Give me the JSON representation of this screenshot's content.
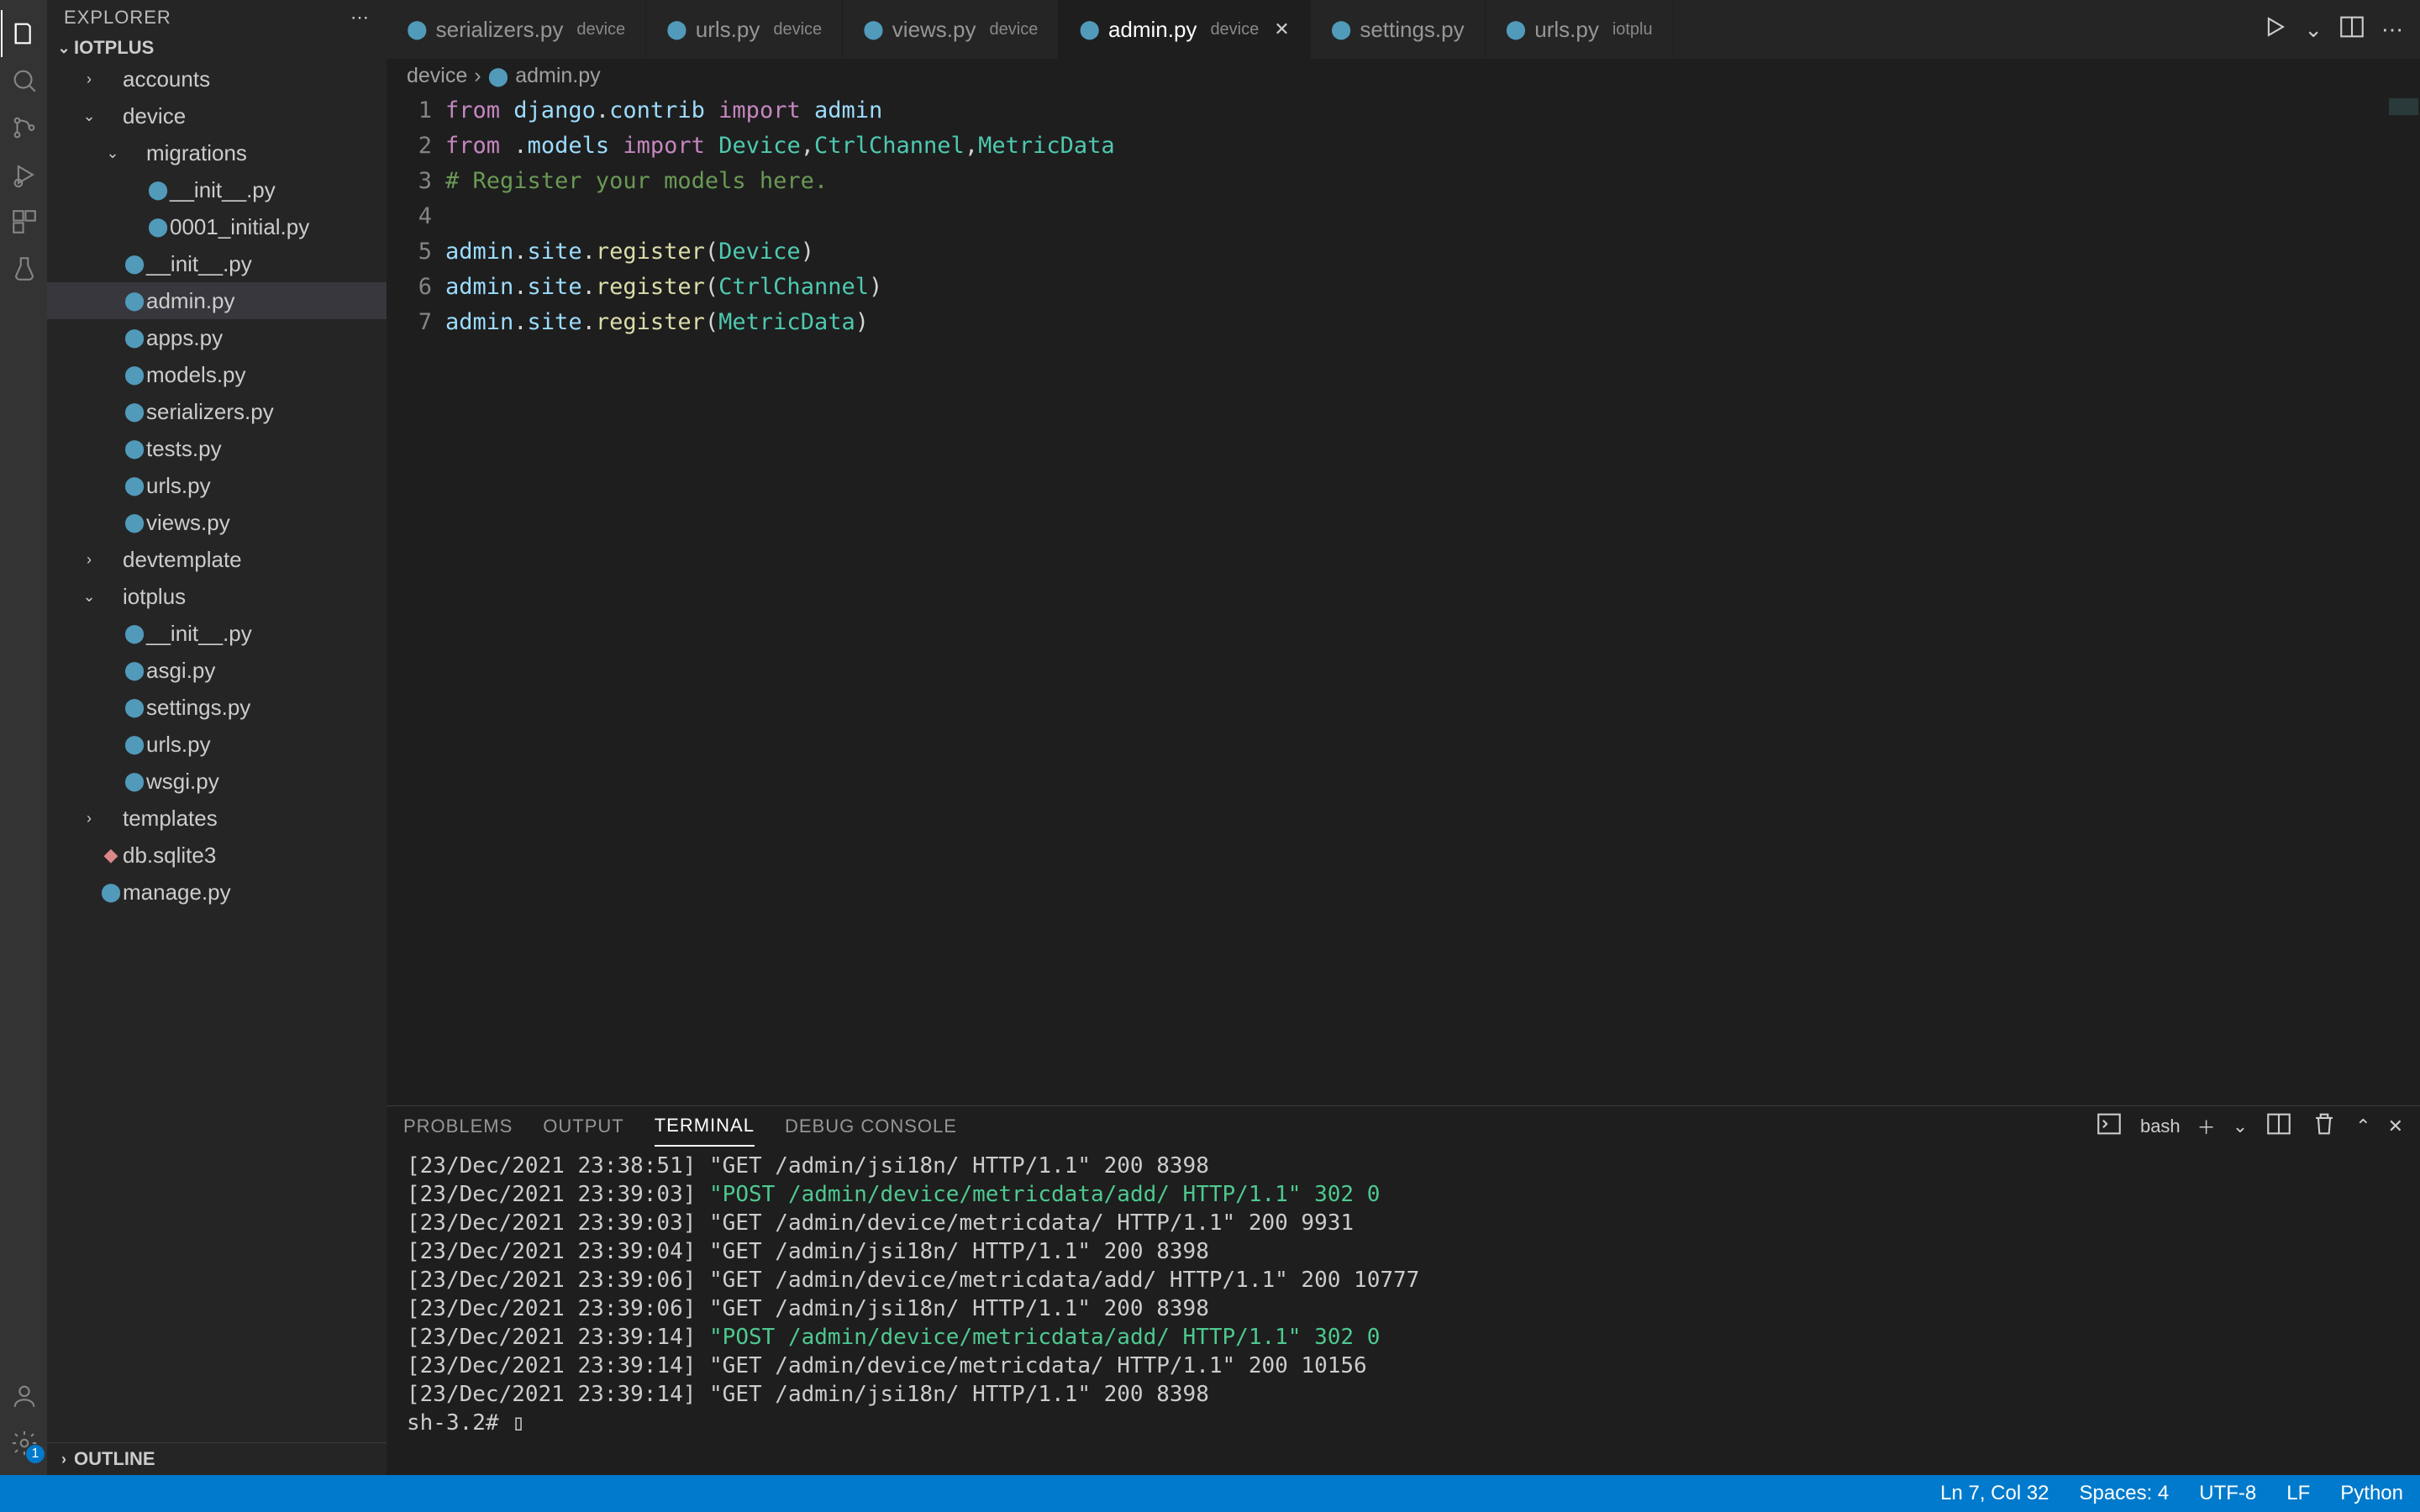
{
  "sidebar": {
    "title": "EXPLORER",
    "project": "IOTPLUS",
    "outline": "OUTLINE",
    "tree": [
      {
        "name": "accounts",
        "type": "folder",
        "indent": 1,
        "open": false
      },
      {
        "name": "device",
        "type": "folder",
        "indent": 1,
        "open": true
      },
      {
        "name": "migrations",
        "type": "folder",
        "indent": 2,
        "open": true
      },
      {
        "name": "__init__.py",
        "type": "py",
        "indent": 3
      },
      {
        "name": "0001_initial.py",
        "type": "py",
        "indent": 3
      },
      {
        "name": "__init__.py",
        "type": "py",
        "indent": 2
      },
      {
        "name": "admin.py",
        "type": "py",
        "indent": 2,
        "selected": true
      },
      {
        "name": "apps.py",
        "type": "py",
        "indent": 2
      },
      {
        "name": "models.py",
        "type": "py",
        "indent": 2
      },
      {
        "name": "serializers.py",
        "type": "py",
        "indent": 2
      },
      {
        "name": "tests.py",
        "type": "py",
        "indent": 2
      },
      {
        "name": "urls.py",
        "type": "py",
        "indent": 2
      },
      {
        "name": "views.py",
        "type": "py",
        "indent": 2
      },
      {
        "name": "devtemplate",
        "type": "folder",
        "indent": 1,
        "open": false
      },
      {
        "name": "iotplus",
        "type": "folder",
        "indent": 1,
        "open": true
      },
      {
        "name": "__init__.py",
        "type": "py",
        "indent": 2
      },
      {
        "name": "asgi.py",
        "type": "py",
        "indent": 2
      },
      {
        "name": "settings.py",
        "type": "py",
        "indent": 2
      },
      {
        "name": "urls.py",
        "type": "py",
        "indent": 2
      },
      {
        "name": "wsgi.py",
        "type": "py",
        "indent": 2
      },
      {
        "name": "templates",
        "type": "folder",
        "indent": 1,
        "open": false
      },
      {
        "name": "db.sqlite3",
        "type": "db",
        "indent": 1
      },
      {
        "name": "manage.py",
        "type": "py",
        "indent": 1
      }
    ]
  },
  "tabs": [
    {
      "label": "serializers.py",
      "detail": "device"
    },
    {
      "label": "urls.py",
      "detail": "device"
    },
    {
      "label": "views.py",
      "detail": "device"
    },
    {
      "label": "admin.py",
      "detail": "device",
      "active": true,
      "close": true
    },
    {
      "label": "settings.py",
      "detail": ""
    },
    {
      "label": "urls.py",
      "detail": "iotplu"
    }
  ],
  "breadcrumbs": {
    "folder": "device",
    "file": "admin.py"
  },
  "code": {
    "lines": [
      {
        "n": "1",
        "html": "<span class='kw'>from</span> <span class='var'>django</span><span class='punc'>.</span><span class='var'>contrib</span> <span class='kw'>import</span> <span class='var'>admin</span>"
      },
      {
        "n": "2",
        "html": "<span class='kw'>from</span> <span class='punc'>.</span><span class='var'>models</span> <span class='kw'>import</span> <span class='cls'>Device</span><span class='punc'>,</span><span class='cls'>CtrlChannel</span><span class='punc'>,</span><span class='cls'>MetricData</span>"
      },
      {
        "n": "3",
        "html": "<span class='cmt'># Register your models here.</span>"
      },
      {
        "n": "4",
        "html": ""
      },
      {
        "n": "5",
        "html": "<span class='var'>admin</span><span class='punc'>.</span><span class='var'>site</span><span class='punc'>.</span><span class='fn'>register</span><span class='punc'>(</span><span class='cls'>Device</span><span class='punc'>)</span>"
      },
      {
        "n": "6",
        "html": "<span class='var'>admin</span><span class='punc'>.</span><span class='var'>site</span><span class='punc'>.</span><span class='fn'>register</span><span class='punc'>(</span><span class='cls'>CtrlChannel</span><span class='punc'>)</span>"
      },
      {
        "n": "7",
        "html": "<span class='var'>admin</span><span class='punc'>.</span><span class='var'>site</span><span class='punc'>.</span><span class='fn'>register</span><span class='punc'>(</span><span class='cls'>MetricData</span><span class='punc'>)</span>"
      }
    ]
  },
  "panel": {
    "tabs": [
      "PROBLEMS",
      "OUTPUT",
      "TERMINAL",
      "DEBUG CONSOLE"
    ],
    "active": "TERMINAL",
    "shell": "bash",
    "lines": [
      {
        "t": "[23/Dec/2021 23:38:51] \"GET /admin/jsi18n/ HTTP/1.1\" 200 8398",
        "cls": ""
      },
      {
        "t": "[23/Dec/2021 23:39:03] ",
        "post": "\"POST /admin/device/metricdata/add/ HTTP/1.1\" 302 0"
      },
      {
        "t": "[23/Dec/2021 23:39:03] \"GET /admin/device/metricdata/ HTTP/1.1\" 200 9931",
        "cls": ""
      },
      {
        "t": "[23/Dec/2021 23:39:04] \"GET /admin/jsi18n/ HTTP/1.1\" 200 8398",
        "cls": ""
      },
      {
        "t": "[23/Dec/2021 23:39:06] \"GET /admin/device/metricdata/add/ HTTP/1.1\" 200 10777",
        "cls": ""
      },
      {
        "t": "[23/Dec/2021 23:39:06] \"GET /admin/jsi18n/ HTTP/1.1\" 200 8398",
        "cls": ""
      },
      {
        "t": "[23/Dec/2021 23:39:14] ",
        "post": "\"POST /admin/device/metricdata/add/ HTTP/1.1\" 302 0"
      },
      {
        "t": "[23/Dec/2021 23:39:14] \"GET /admin/device/metricdata/ HTTP/1.1\" 200 10156",
        "cls": ""
      },
      {
        "t": "[23/Dec/2021 23:39:14] \"GET /admin/jsi18n/ HTTP/1.1\" 200 8398",
        "cls": ""
      },
      {
        "t": "sh-3.2# ▯",
        "cls": ""
      }
    ]
  },
  "statusbar": {
    "pos": "Ln 7, Col 32",
    "spaces": "Spaces: 4",
    "encoding": "UTF-8",
    "eol": "LF",
    "lang": "Python"
  },
  "activity_badge": "1"
}
